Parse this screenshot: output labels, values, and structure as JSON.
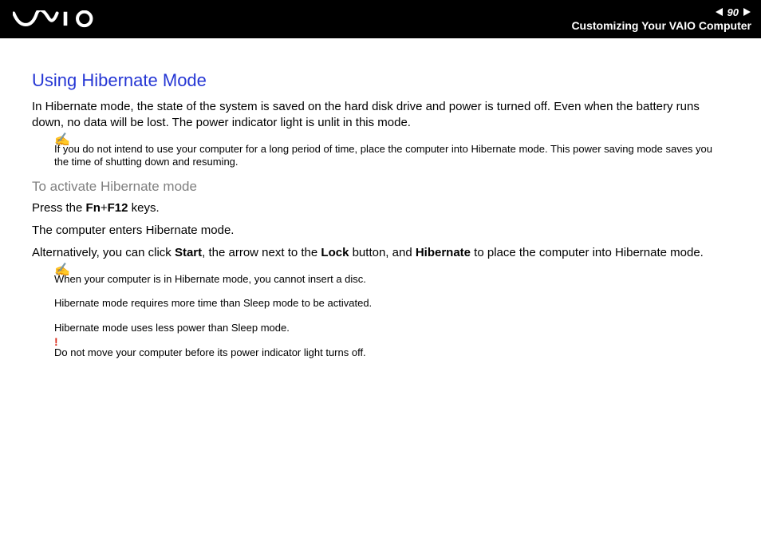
{
  "header": {
    "page_number": "90",
    "section": "Customizing Your VAIO Computer"
  },
  "h1": "Using Hibernate Mode",
  "intro": "In Hibernate mode, the state of the system is saved on the hard disk drive and power is turned off. Even when the battery runs down, no data will be lost. The power indicator light is unlit in this mode.",
  "note1": "If you do not intend to use your computer for a long period of time, place the computer into Hibernate mode. This power saving mode saves you the time of shutting down and resuming.",
  "h2": "To activate Hibernate mode",
  "step1_pre": "Press the ",
  "step1_bold": "Fn",
  "step1_plus": "+",
  "step1_bold2": "F12",
  "step1_post": " keys.",
  "step2": "The computer enters Hibernate mode.",
  "alt_pre": "Alternatively, you can click ",
  "alt_b1": "Start",
  "alt_mid1": ", the arrow next to the ",
  "alt_b2": "Lock",
  "alt_mid2": " button, and ",
  "alt_b3": "Hibernate",
  "alt_post": " to place the computer into Hibernate mode.",
  "notes": {
    "n1": "When your computer is in Hibernate mode, you cannot insert a disc.",
    "n2": "Hibernate mode requires more time than Sleep mode to be activated.",
    "n3": "Hibernate mode uses less power than Sleep mode."
  },
  "warn": "Do not move your computer before its power indicator light turns off."
}
